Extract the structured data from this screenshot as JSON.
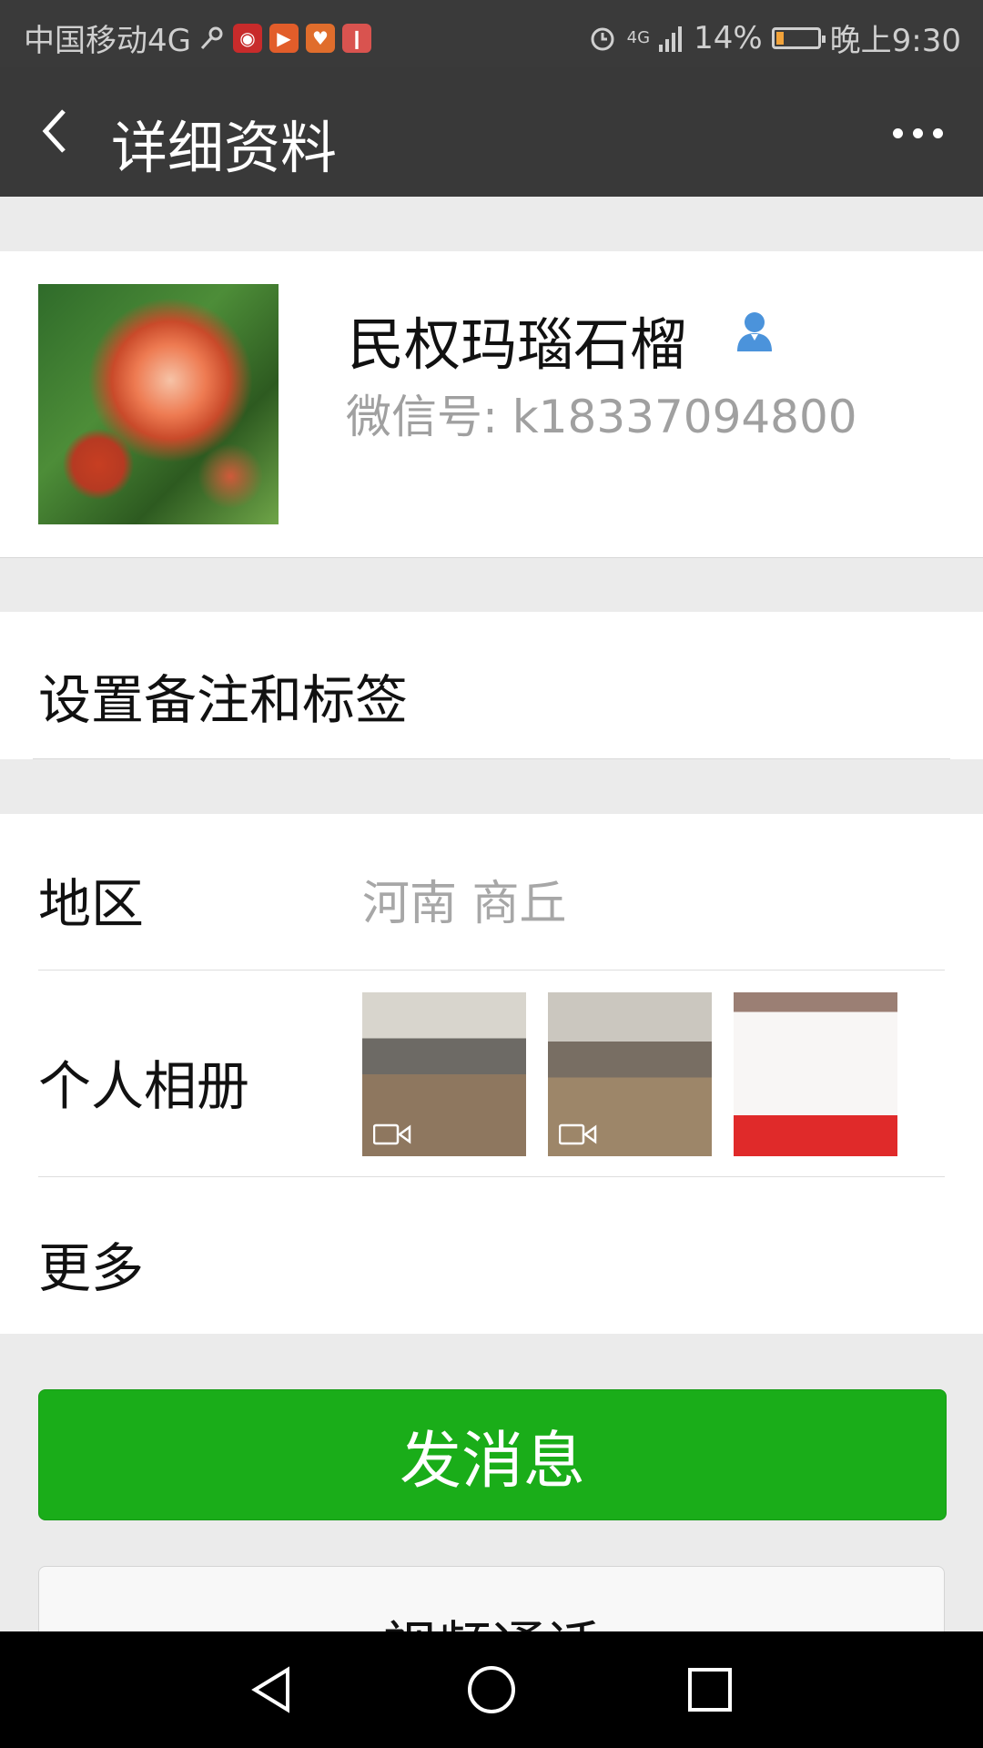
{
  "status_bar": {
    "carrier": "中国移动4G",
    "battery_percent": "14%",
    "time": "晚上9:30",
    "network": "4G",
    "battery_level": 0.14
  },
  "header": {
    "title": "详细资料"
  },
  "profile": {
    "name": "民权玛瑙石榴",
    "wechat_id": "微信号: k18337094800"
  },
  "remark": {
    "label": "设置备注和标签"
  },
  "details": {
    "region_label": "地区",
    "region_value": "河南  商丘",
    "album_label": "个人相册",
    "more_label": "更多"
  },
  "actions": {
    "send_message": "发消息",
    "video_call": "视频通话"
  },
  "colors": {
    "accent_green": "#1aad19",
    "titlebar": "#393939",
    "background": "#ebebeb"
  },
  "icons": {
    "back": "back-arrow-icon",
    "more": "more-dots-icon",
    "contact": "contact-person-icon",
    "video": "video-camera-icon"
  }
}
